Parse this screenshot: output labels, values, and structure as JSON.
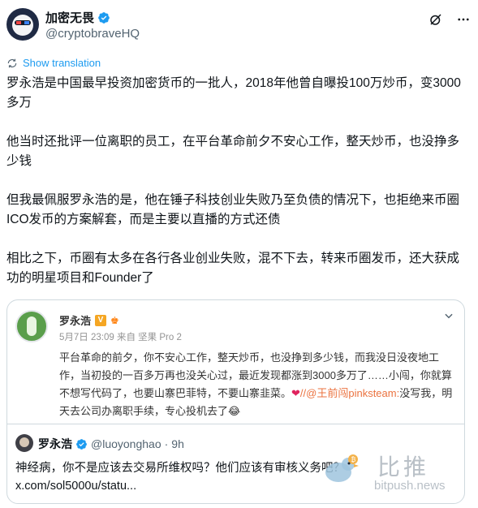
{
  "account": {
    "display_name": "加密无畏",
    "handle": "@cryptobraveHQ"
  },
  "translate_label": "Show translation",
  "tweet": {
    "paragraphs": [
      "罗永浩是中国最早投资加密货币的一批人，2018年他曾自曝投100万炒币，变3000多万",
      "他当时还批评一位离职的员工，在平台革命前夕不安心工作，整天炒币，也没挣多少钱",
      "但我最佩服罗永浩的是，他在锤子科技创业失败乃至负债的情况下，也拒绝来币圈 ICO发币的方案解套，而是主要以直播的方式还债",
      "相比之下，币圈有太多在各行各业创业失败，混不下去，转来币圈发币，还大获成功的明星项目和Founder了"
    ]
  },
  "weibo": {
    "name": "罗永浩",
    "vip_badge": "V",
    "meta": "5月7日 23:09 来自 坚果 Pro 2",
    "text_main": "平台革命的前夕，你不安心工作，整天炒币，也没挣到多少钱，而我没日没夜地工作，当初投的一百多万再也没关心过，最近发现都涨到3000多万了……小闯，你就算不想写代码了，也要山寨巴菲特，不要山寨韭菜。",
    "heart": "❤",
    "mention": "//@王前闯pinksteam:",
    "text_tail": "没写我，明天去公司办离职手续，专心投机去了",
    "emoji": "😂"
  },
  "quote": {
    "name": "罗永浩",
    "handle": "@luoyonghao",
    "separator": "·",
    "time": "9h",
    "line1": "神经病，你不是应该去交易所维权吗？他们应该有审核义务吧？",
    "line2": "x.com/sol5000u/statu..."
  },
  "watermark": {
    "cn": "比推",
    "en": "bitpush.news"
  },
  "colors": {
    "link_blue": "#1d9bf0",
    "verified_blue": "#1d9bf0",
    "text_primary": "#0f1419",
    "text_secondary": "#536471",
    "weibo_mention": "#eb7340"
  }
}
